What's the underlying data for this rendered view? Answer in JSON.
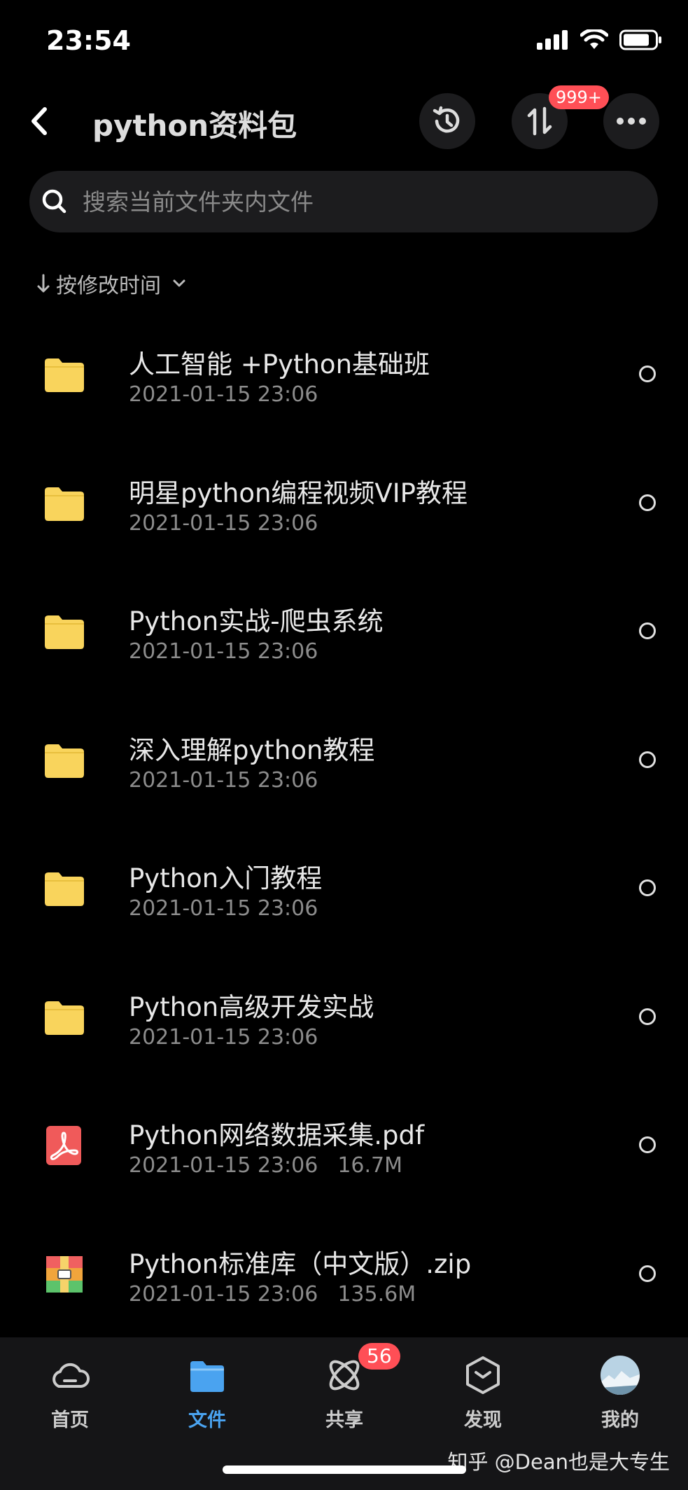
{
  "status": {
    "time": "23:54"
  },
  "header": {
    "title": "python资料包",
    "transfer_badge": "999+"
  },
  "search": {
    "placeholder": "搜索当前文件夹内文件"
  },
  "sort": {
    "label": "按修改时间"
  },
  "files": [
    {
      "name": "人工智能 +Python基础班",
      "date": "2021-01-15 23:06",
      "size": "",
      "type": "folder"
    },
    {
      "name": "明星python编程视频VIP教程",
      "date": "2021-01-15 23:06",
      "size": "",
      "type": "folder"
    },
    {
      "name": "Python实战-爬虫系统",
      "date": "2021-01-15 23:06",
      "size": "",
      "type": "folder"
    },
    {
      "name": "深入理解python教程",
      "date": "2021-01-15 23:06",
      "size": "",
      "type": "folder"
    },
    {
      "name": "Python入门教程",
      "date": "2021-01-15 23:06",
      "size": "",
      "type": "folder"
    },
    {
      "name": "Python高级开发实战",
      "date": "2021-01-15 23:06",
      "size": "",
      "type": "folder"
    },
    {
      "name": "Python网络数据采集.pdf",
      "date": "2021-01-15 23:06",
      "size": "16.7M",
      "type": "pdf"
    },
    {
      "name": "Python标准库（中文版）.zip",
      "date": "2021-01-15 23:06",
      "size": "135.6M",
      "type": "zip"
    }
  ],
  "tabs": [
    {
      "label": "首页",
      "icon": "cloud-icon"
    },
    {
      "label": "文件",
      "icon": "folder-icon",
      "active": true
    },
    {
      "label": "共享",
      "icon": "share-icon",
      "badge": "56"
    },
    {
      "label": "发现",
      "icon": "discover-icon"
    },
    {
      "label": "我的",
      "icon": "avatar-icon"
    }
  ],
  "watermark": "知乎 @Dean也是大专生",
  "colors": {
    "accent": "#4aa3f0",
    "folder": "#f9d45c",
    "badge": "#ff4f56",
    "background": "#000000"
  }
}
